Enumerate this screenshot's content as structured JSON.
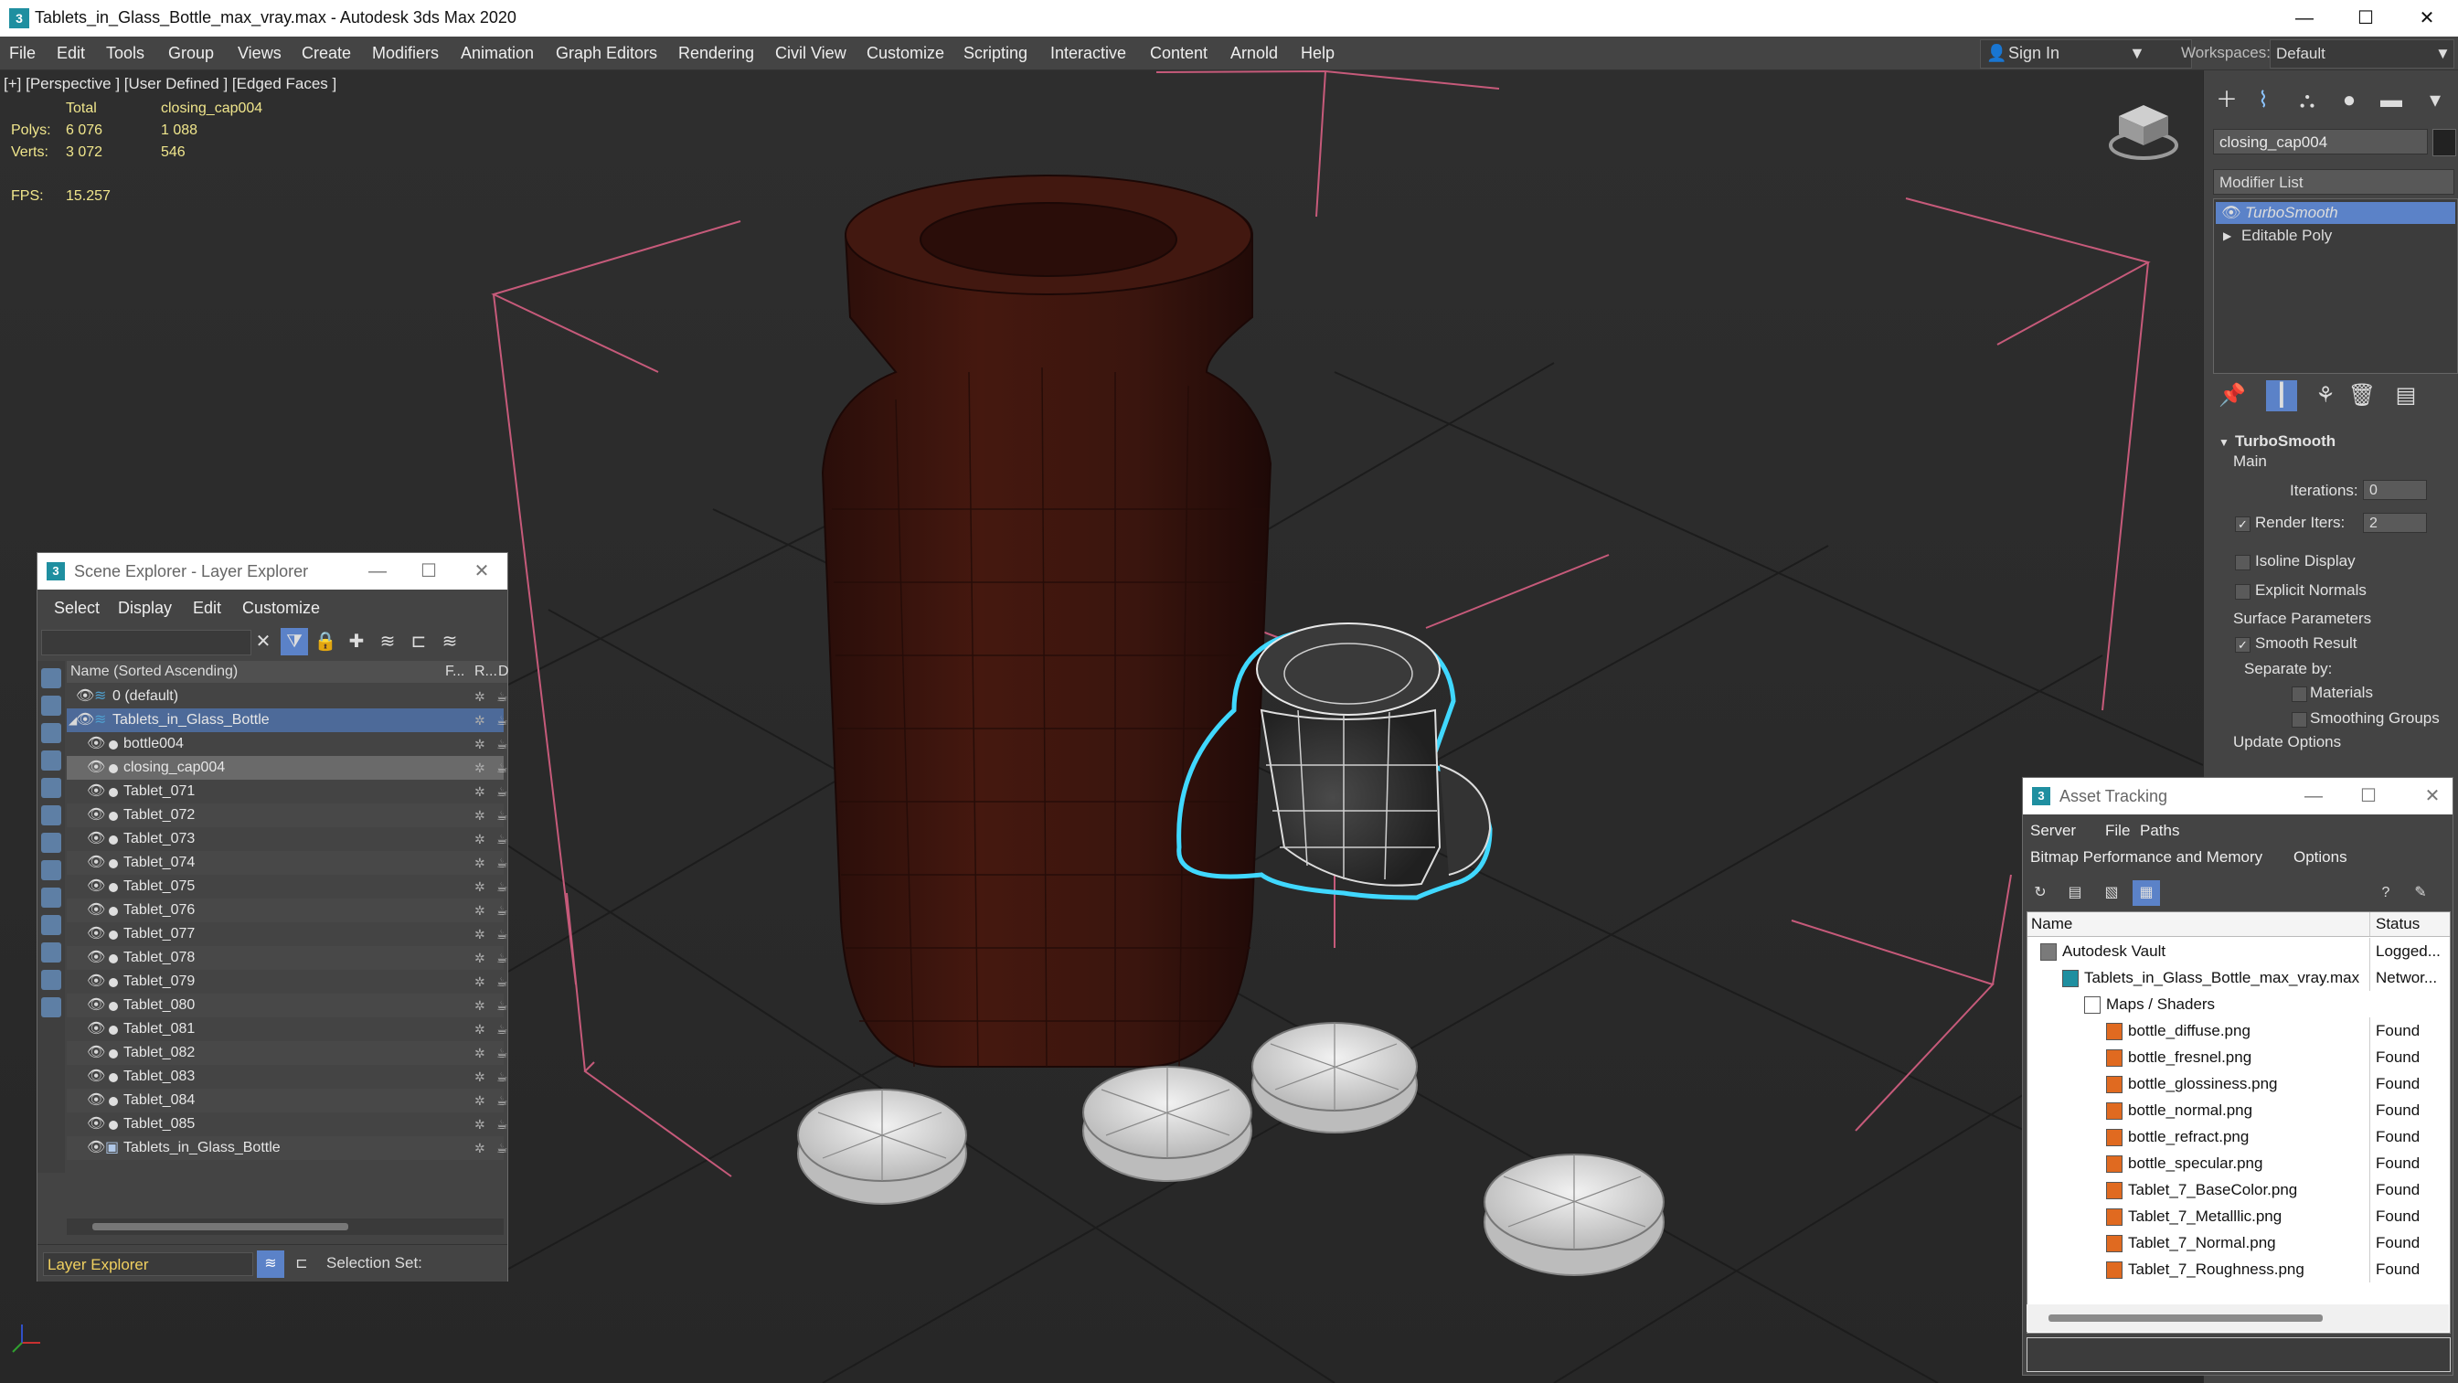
{
  "window": {
    "title": "Tablets_in_Glass_Bottle_max_vray.max - Autodesk 3ds Max 2020",
    "minimize": "—",
    "maximize": "☐",
    "close": "✕"
  },
  "menubar": {
    "items": [
      "File",
      "Edit",
      "Tools",
      "Group",
      "Views",
      "Create",
      "Modifiers",
      "Animation",
      "Graph Editors",
      "Rendering",
      "Civil View",
      "Customize",
      "Scripting",
      "Interactive",
      "Content",
      "Arnold",
      "Help"
    ],
    "signin": "Sign In",
    "workspaces_label": "Workspaces:",
    "workspace": "Default"
  },
  "viewport": {
    "label": "[+] [Perspective ] [User Defined ] [Edged Faces ]",
    "stats": {
      "total_label": "Total",
      "selected_name": "closing_cap004",
      "polys_label": "Polys:",
      "polys_total": "6 076",
      "polys_sel": "1 088",
      "verts_label": "Verts:",
      "verts_total": "3 072",
      "verts_sel": "546",
      "fps_label": "FPS:",
      "fps": "15.257"
    }
  },
  "command_panel": {
    "object_name": "closing_cap004",
    "modifier_list": "Modifier List",
    "stack": [
      "TurboSmooth",
      "Editable Poly"
    ],
    "rollout": {
      "title": "TurboSmooth",
      "main": "Main",
      "iterations_label": "Iterations:",
      "iterations": "0",
      "render_iters_label": "Render Iters:",
      "render_iters": "2",
      "isoline": "Isoline Display",
      "explicit_normals": "Explicit Normals",
      "surface_params": "Surface Parameters",
      "smooth_result": "Smooth Result",
      "separate_by": "Separate by:",
      "materials": "Materials",
      "smoothing_groups": "Smoothing Groups",
      "update_options": "Update Options"
    }
  },
  "scene_explorer": {
    "title": "Scene Explorer - Layer Explorer",
    "menu": [
      "Select",
      "Display",
      "Edit",
      "Customize"
    ],
    "header_name": "Name (Sorted Ascending)",
    "header_f": "F...",
    "header_r": "R...",
    "header_d": "D",
    "rows": [
      {
        "label": "0 (default)",
        "indent": 1
      },
      {
        "label": "Tablets_in_Glass_Bottle",
        "indent": 1
      },
      {
        "label": "bottle004",
        "indent": 2
      },
      {
        "label": "closing_cap004",
        "indent": 2
      },
      {
        "label": "Tablet_071",
        "indent": 2
      },
      {
        "label": "Tablet_072",
        "indent": 2
      },
      {
        "label": "Tablet_073",
        "indent": 2
      },
      {
        "label": "Tablet_074",
        "indent": 2
      },
      {
        "label": "Tablet_075",
        "indent": 2
      },
      {
        "label": "Tablet_076",
        "indent": 2
      },
      {
        "label": "Tablet_077",
        "indent": 2
      },
      {
        "label": "Tablet_078",
        "indent": 2
      },
      {
        "label": "Tablet_079",
        "indent": 2
      },
      {
        "label": "Tablet_080",
        "indent": 2
      },
      {
        "label": "Tablet_081",
        "indent": 2
      },
      {
        "label": "Tablet_082",
        "indent": 2
      },
      {
        "label": "Tablet_083",
        "indent": 2
      },
      {
        "label": "Tablet_084",
        "indent": 2
      },
      {
        "label": "Tablet_085",
        "indent": 2
      },
      {
        "label": "Tablets_in_Glass_Bottle",
        "indent": 2
      }
    ],
    "layer_mode": "Layer Explorer",
    "selection_set_label": "Selection Set:"
  },
  "asset_tracking": {
    "title": "Asset Tracking",
    "menu1": [
      "Server",
      "File",
      "Paths"
    ],
    "menu2": [
      "Bitmap Performance and Memory",
      "Options"
    ],
    "col_name": "Name",
    "col_status": "Status",
    "rows": [
      {
        "name": "Autodesk Vault",
        "status": "Logged...",
        "level": 0
      },
      {
        "name": "Tablets_in_Glass_Bottle_max_vray.max",
        "status": "Networ...",
        "level": 1
      },
      {
        "name": "Maps / Shaders",
        "status": "",
        "level": 2
      },
      {
        "name": "bottle_diffuse.png",
        "status": "Found",
        "level": 3
      },
      {
        "name": "bottle_fresnel.png",
        "status": "Found",
        "level": 3
      },
      {
        "name": "bottle_glossiness.png",
        "status": "Found",
        "level": 3
      },
      {
        "name": "bottle_normal.png",
        "status": "Found",
        "level": 3
      },
      {
        "name": "bottle_refract.png",
        "status": "Found",
        "level": 3
      },
      {
        "name": "bottle_specular.png",
        "status": "Found",
        "level": 3
      },
      {
        "name": "Tablet_7_BaseColor.png",
        "status": "Found",
        "level": 3
      },
      {
        "name": "Tablet_7_Metalllic.png",
        "status": "Found",
        "level": 3
      },
      {
        "name": "Tablet_7_Normal.png",
        "status": "Found",
        "level": 3
      },
      {
        "name": "Tablet_7_Roughness.png",
        "status": "Found",
        "level": 3
      }
    ]
  },
  "colors": {
    "accent": "#5b82c8",
    "selection_cyan": "#40d8ff",
    "stats_yellow": "#f0e68c",
    "bottle_brown": "#3b1610"
  }
}
